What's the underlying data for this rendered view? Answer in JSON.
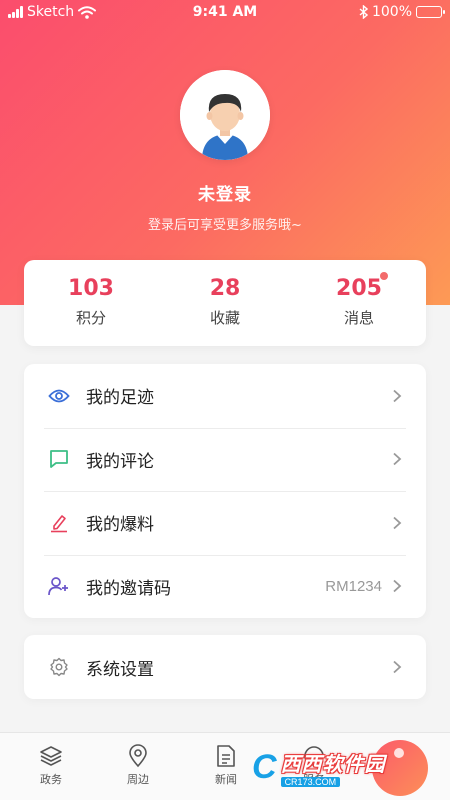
{
  "status_bar": {
    "carrier": "Sketch",
    "time": "9:41 AM",
    "battery": "100%"
  },
  "profile": {
    "name": "未登录",
    "hint": "登录后可享受更多服务哦~"
  },
  "stats": [
    {
      "value": "103",
      "label": "积分"
    },
    {
      "value": "28",
      "label": "收藏"
    },
    {
      "value": "205",
      "label": "消息"
    }
  ],
  "menu": [
    {
      "label": "我的足迹",
      "icon": "eye-icon",
      "color": "#3b6fd8"
    },
    {
      "label": "我的评论",
      "icon": "comment-icon",
      "color": "#3dbf86"
    },
    {
      "label": "我的爆料",
      "icon": "pencil-icon",
      "color": "#e8405c"
    },
    {
      "label": "我的邀请码",
      "icon": "add-user-icon",
      "color": "#6a55c9",
      "value": "RM1234"
    }
  ],
  "settings": {
    "label": "系统设置",
    "icon": "gear-icon"
  },
  "tabs": [
    {
      "label": "政务",
      "icon": "layers-icon"
    },
    {
      "label": "周边",
      "icon": "location-pin-icon"
    },
    {
      "label": "新闻",
      "icon": "document-icon"
    },
    {
      "label": "服务",
      "icon": "service-icon"
    }
  ],
  "watermark": {
    "name": "西西软件园",
    "site": "CR173.COM"
  },
  "colors": {
    "accent": "#e8405c",
    "gradient_start": "#fb4d6d",
    "gradient_end": "#fd9a55"
  }
}
